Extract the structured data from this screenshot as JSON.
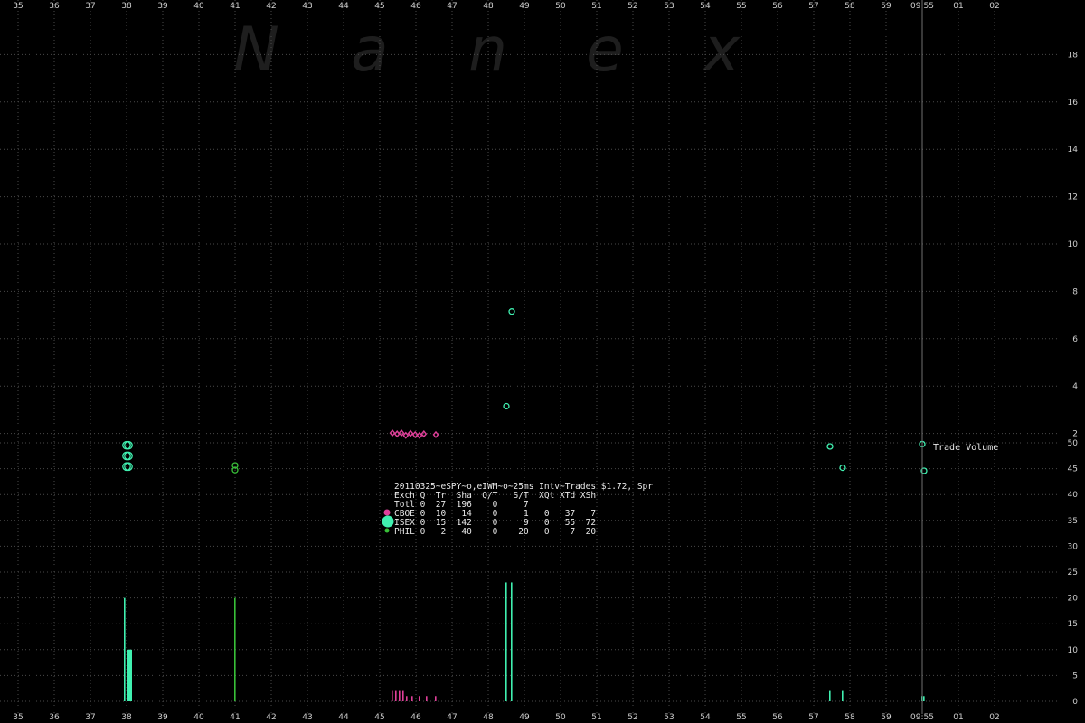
{
  "watermark": [
    "N",
    "a",
    "n",
    "e",
    "x"
  ],
  "x_ticks": [
    "35",
    "36",
    "37",
    "38",
    "39",
    "40",
    "41",
    "42",
    "43",
    "44",
    "45",
    "46",
    "47",
    "48",
    "49",
    "50",
    "51",
    "52",
    "53",
    "54",
    "55",
    "56",
    "57",
    "58",
    "59",
    "09:55",
    "01",
    "02"
  ],
  "colors": {
    "background": "#000000",
    "grid": "#4a4a4a",
    "CBOE": "#e0409a",
    "ISEX": "#40f0b0",
    "PHIL": "#38c038"
  },
  "legend": {
    "title": "20110325~eSPY~o,eIWM~o~25ms Intv~Trades $1.72, Spr",
    "header": "Exch Q  Tr  Sha  Q/T   S/T  XQt XTd XSh",
    "rows": [
      {
        "exch": "Totl",
        "text": "Totl 0  27  196    0     7"
      },
      {
        "exch": "CBOE",
        "text": "CBOE 0  10   14    0     1   0   37   7"
      },
      {
        "exch": "ISEX",
        "text": "ISEX 0  15  142    0     9   0   55  72"
      },
      {
        "exch": "PHIL",
        "text": "PHIL 0   2   40    0    20   0    7  20"
      }
    ]
  },
  "volume_label": "Trade Volume",
  "chart_data": [
    {
      "type": "scatter",
      "title": "",
      "xlabel": "",
      "ylabel": "",
      "x_range": [
        35,
        63
      ],
      "ylim": [
        0,
        18
      ],
      "y_ticks": [
        2,
        4,
        6,
        8,
        10,
        12,
        14,
        16,
        18
      ],
      "grid": true,
      "series": [
        {
          "name": "CBOE",
          "points": [
            [
              45.35,
              2.02
            ],
            [
              45.48,
              1.98
            ],
            [
              45.6,
              2.02
            ],
            [
              45.72,
              1.92
            ],
            [
              45.85,
              2.0
            ],
            [
              45.98,
              1.95
            ],
            [
              46.1,
              1.92
            ],
            [
              46.22,
              1.98
            ],
            [
              46.55,
              1.95
            ]
          ]
        },
        {
          "name": "ISEX",
          "points": [
            [
              38.0,
              1.5
            ],
            [
              38.05,
              1.5
            ],
            [
              38.0,
              1.05
            ],
            [
              38.05,
              1.05
            ],
            [
              38.0,
              0.6
            ],
            [
              38.05,
              0.6
            ],
            [
              48.5,
              3.15
            ],
            [
              48.65,
              7.15
            ],
            [
              57.45,
              1.45
            ],
            [
              57.8,
              0.55
            ],
            [
              60.0,
              1.55
            ],
            [
              60.05,
              0.42
            ]
          ]
        },
        {
          "name": "PHIL",
          "points": [
            [
              41.0,
              0.65
            ],
            [
              41.0,
              0.45
            ]
          ]
        }
      ]
    },
    {
      "type": "bar",
      "title": "Trade Volume",
      "xlabel": "",
      "ylabel": "",
      "x_range": [
        35,
        63
      ],
      "ylim": [
        0,
        50
      ],
      "y_ticks": [
        0,
        5,
        10,
        15,
        20,
        25,
        30,
        35,
        40,
        45,
        50
      ],
      "grid": true,
      "series": [
        {
          "name": "ISEX",
          "bars": [
            [
              37.95,
              20
            ],
            [
              38.05,
              10
            ],
            [
              38.1,
              10
            ],
            [
              48.5,
              23
            ],
            [
              48.65,
              23
            ],
            [
              57.45,
              2
            ],
            [
              57.8,
              2
            ],
            [
              60.0,
              1
            ],
            [
              60.05,
              1
            ]
          ]
        },
        {
          "name": "PHIL",
          "bars": [
            [
              41.0,
              20
            ]
          ]
        },
        {
          "name": "CBOE",
          "bars": [
            [
              45.35,
              2
            ],
            [
              45.45,
              2
            ],
            [
              45.55,
              2
            ],
            [
              45.65,
              2
            ],
            [
              45.75,
              1
            ],
            [
              45.9,
              1
            ],
            [
              46.1,
              1
            ],
            [
              46.3,
              1
            ],
            [
              46.55,
              1
            ]
          ]
        }
      ]
    }
  ]
}
